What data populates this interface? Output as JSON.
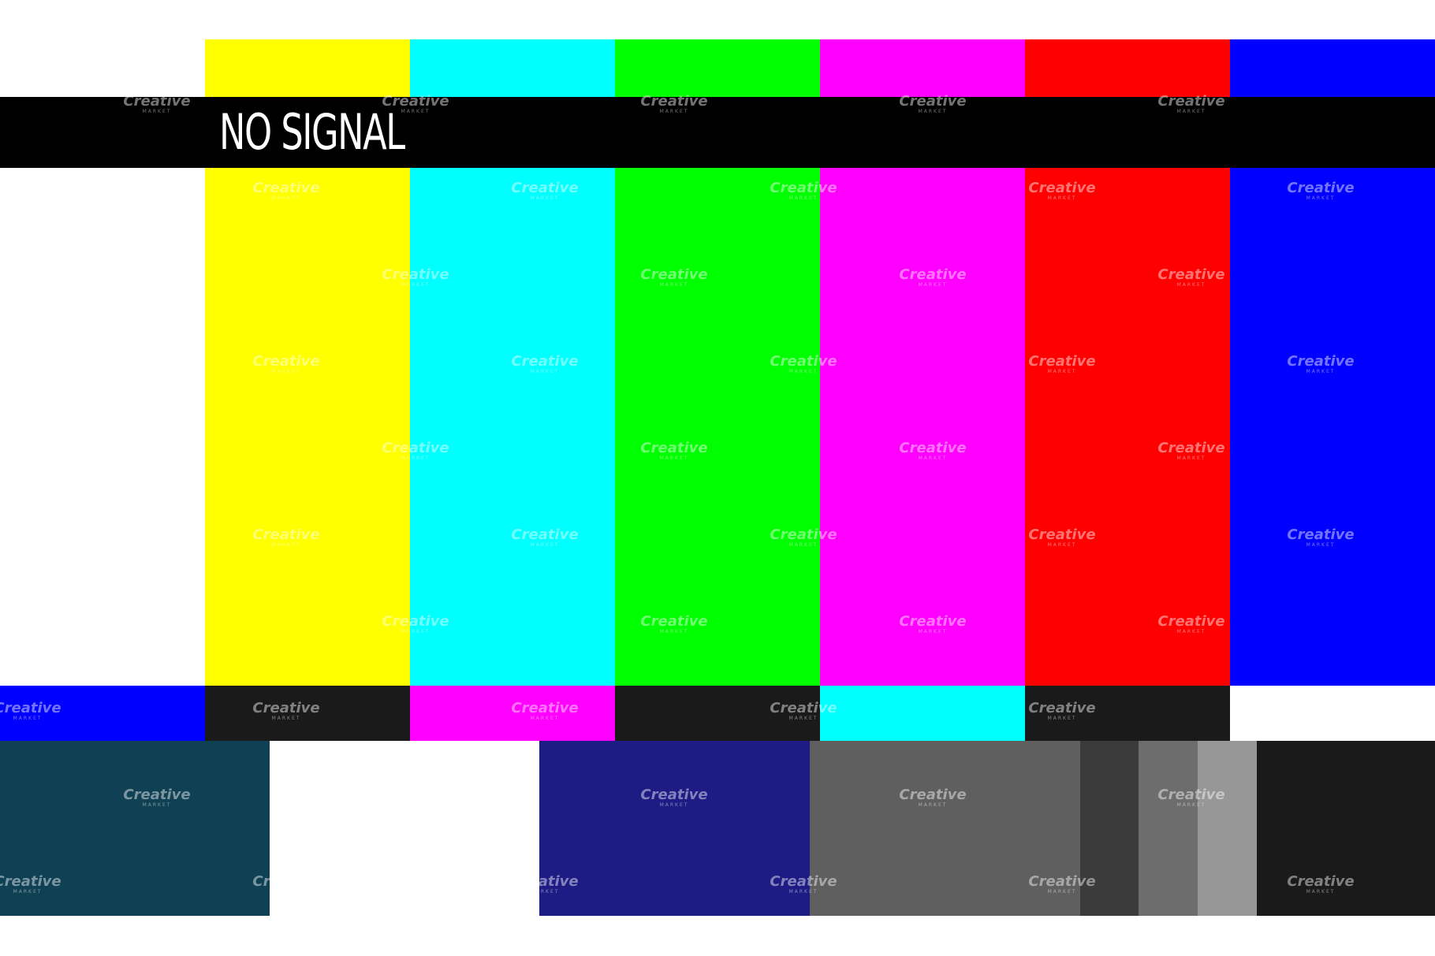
{
  "banner": {
    "text": "NO SIGNAL"
  },
  "colors": {
    "background": "#ffffff",
    "banner": "#000000",
    "top_bars": [
      "#ffffff",
      "#ffff00",
      "#00ffff",
      "#00ff00",
      "#ff00ff",
      "#ff0000",
      "#0000ff"
    ],
    "castellations": [
      "#0000ff",
      "#1a1a1a",
      "#ff00ff",
      "#1a1a1a",
      "#00ffff",
      "#1a1a1a",
      "#ffffff"
    ],
    "bottom_blocks": [
      "#0f4054",
      "#ffffff",
      "#1d1c85",
      "#5f5f5f",
      "#3b3b3b",
      "#6d6d6d",
      "#979797",
      "#1a1a1a"
    ]
  },
  "watermark": {
    "title": "Creative",
    "subtitle": "MARKET"
  }
}
